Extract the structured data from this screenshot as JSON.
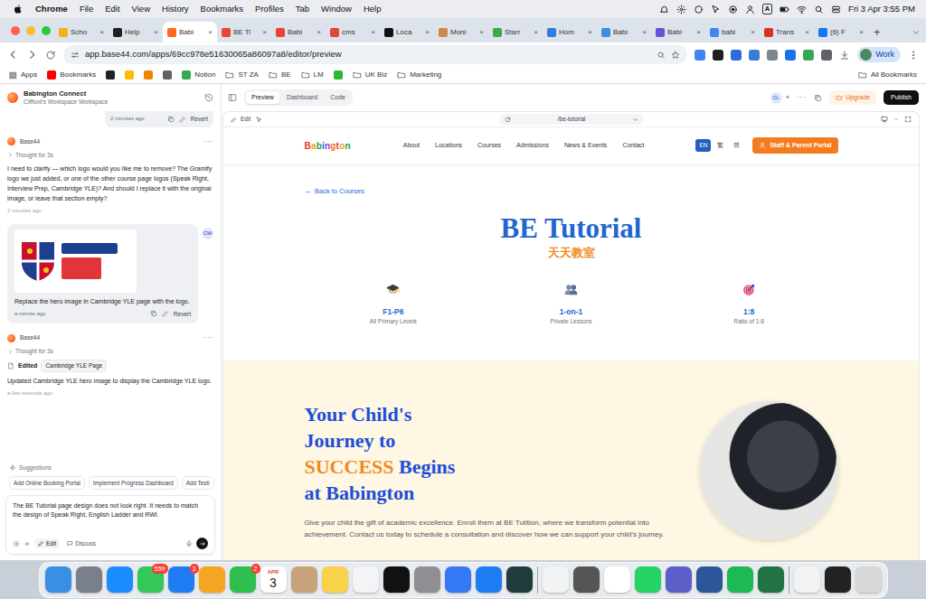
{
  "menubar": {
    "app": "Chrome",
    "menus": [
      "File",
      "Edit",
      "View",
      "History",
      "Bookmarks",
      "Profiles",
      "Tab",
      "Window",
      "Help"
    ],
    "input_source": "A",
    "clock": "Fri 3 Apr 3:55 PM"
  },
  "browser": {
    "tabs": [
      {
        "label": "Scho",
        "selected": false,
        "color": "#f2b01e"
      },
      {
        "label": "Help",
        "selected": false,
        "color": "#202124"
      },
      {
        "label": "Babi",
        "selected": true,
        "color": "#ff6a1f"
      },
      {
        "label": "BE Ti",
        "selected": false,
        "color": "#e8453c"
      },
      {
        "label": "Babi",
        "selected": false,
        "color": "#ea4335"
      },
      {
        "label": "cms",
        "selected": false,
        "color": "#e0463a"
      },
      {
        "label": "Loca",
        "selected": false,
        "color": "#111111"
      },
      {
        "label": "Moni",
        "selected": false,
        "color": "#c98b4b"
      },
      {
        "label": "Starr",
        "selected": false,
        "color": "#3ea84a"
      },
      {
        "label": "Hom",
        "selected": false,
        "color": "#2f7de1"
      },
      {
        "label": "Babi",
        "selected": false,
        "color": "#3b8fe0"
      },
      {
        "label": "Babi",
        "selected": false,
        "color": "#6b4fd8"
      },
      {
        "label": "babi",
        "selected": false,
        "color": "#4285f4"
      },
      {
        "label": "Trans",
        "selected": false,
        "color": "#d93025"
      },
      {
        "label": "(6) F",
        "selected": false,
        "color": "#1877f2"
      }
    ],
    "tab_close": "×",
    "new_tab": "+",
    "url": "app.base44.com/apps/69cc978e51630065a86097a8/editor/preview",
    "extensions": [
      {
        "color": "#4285f4"
      },
      {
        "color": "#1f1f1f"
      },
      {
        "color": "#2c6bd8"
      },
      {
        "color": "#3a7bd5"
      },
      {
        "color": "#7d8590"
      },
      {
        "color": "#1a73e8"
      },
      {
        "color": "#34a853"
      },
      {
        "color": "#5f6368"
      }
    ],
    "profile": "Work",
    "bookmarks": [
      {
        "kind": "apps",
        "label": "Apps"
      },
      {
        "kind": "link",
        "label": "Bookmarks",
        "color": "#ff0000"
      },
      {
        "kind": "icon",
        "color": "#202124"
      },
      {
        "kind": "icon",
        "color": "#fbbc04"
      },
      {
        "kind": "icon",
        "color": "#ea8600"
      },
      {
        "kind": "icon",
        "color": "#5f6368"
      },
      {
        "kind": "link",
        "label": "Notion",
        "color": "#34a853"
      },
      {
        "kind": "folder",
        "label": "ST ZA"
      },
      {
        "kind": "folder",
        "label": "BE"
      },
      {
        "kind": "folder",
        "label": "LM"
      },
      {
        "kind": "icon",
        "color": "#2eb82e"
      },
      {
        "kind": "folder",
        "label": "UK Biz"
      },
      {
        "kind": "folder",
        "label": "Marketing"
      }
    ],
    "all_bookmarks": "All Bookmarks"
  },
  "app": {
    "project": {
      "name": "Babington Connect",
      "workspace": "Clifford's Workspace Workspace"
    },
    "chat": {
      "messages": [
        {
          "kind": "user-tail",
          "time": "2 minutes ago",
          "action": "Revert"
        },
        {
          "kind": "assistant",
          "author": "Base44",
          "menu": "···",
          "thought": "Thought for 3s",
          "text": "I need to clarify — which logo would you like me to remove? The Gramify logo we just added, or one of the other course page logos (Speak Right, Interview Prep, Cambridge YLE)? And should I replace it with the original image, or leave that section empty?",
          "time": "2 minutes ago"
        },
        {
          "kind": "user",
          "avatar": "CW",
          "text": "Replace the hero image in Cambridge YLE page with the logo.",
          "time": "a minute ago",
          "action": "Revert"
        },
        {
          "kind": "assistant-edit",
          "author": "Base44",
          "menu": "···",
          "thought": "Thought for 3s",
          "edited": "Edited",
          "file": "Cambridge YLE Page",
          "text": "Updated Cambridge YLE hero image to display the Cambridge YLE logo.",
          "time": "a few seconds ago"
        }
      ],
      "suggestions_label": "Suggestions",
      "suggestions": [
        "Add Online Booking Portal",
        "Implement Progress Dashboard",
        "Add Testi"
      ],
      "input": "The BE Tutorial page design does not look right. It needs to match the design of Speak Right, English Ladder and RWI.",
      "modes": [
        {
          "label": "Edit",
          "selected": true
        },
        {
          "label": "Discuss",
          "selected": false
        }
      ]
    },
    "views": [
      {
        "label": "Preview",
        "selected": true
      },
      {
        "label": "Dashboard",
        "selected": false
      },
      {
        "label": "Code",
        "selected": false
      }
    ],
    "collaborator": "CL",
    "invite": "+",
    "more": "···",
    "upgrade": "Upgrade",
    "publish": "Publish",
    "preview_edit": "Edit",
    "route": "/be-tutorial"
  },
  "site": {
    "logo": "Babington",
    "nav": [
      "About",
      "Locations",
      "Courses",
      "Admissions",
      "News & Events",
      "Contact"
    ],
    "languages": [
      {
        "label": "EN",
        "selected": true
      },
      {
        "label": "繁",
        "selected": false
      },
      {
        "label": "简",
        "selected": false
      }
    ],
    "portal": "Staff & Parent Portal",
    "back_arrow": "←",
    "back": "Back to Courses",
    "title": "BE Tutorial",
    "subtitle": "天天教室",
    "stats": [
      {
        "kind": "cap",
        "value": "F1-P6",
        "label": "All Primary Levels"
      },
      {
        "kind": "people",
        "value": "1-on-1",
        "label": "Private Lessons"
      },
      {
        "kind": "target",
        "value": "1:8",
        "label": "Ratio of 1:8"
      }
    ],
    "hero": {
      "heading_before": "Your Child's Journey to",
      "highlight": "SUCCESS",
      "heading_after": "Begins at Babington",
      "text": "Give your child the gift of academic excellence. Enroll them at BE Tutition, where we transform potential into achievement. Contact us today to schedule a consultation and discover how we can support your child's journey."
    }
  },
  "dock": {
    "items": [
      {
        "kind": "app",
        "color": "#3a8ee6"
      },
      {
        "kind": "app",
        "color": "#7a7f8c"
      },
      {
        "kind": "app",
        "color": "#1a8cff"
      },
      {
        "kind": "app",
        "color": "#34c759",
        "badge": "559"
      },
      {
        "kind": "app",
        "color": "#1f7cf2",
        "badge": "3"
      },
      {
        "kind": "app",
        "color": "#f5a623"
      },
      {
        "kind": "app",
        "color": "#2fbf4f",
        "badge": "2"
      },
      {
        "kind": "calendar",
        "month": "APR",
        "day": "3"
      },
      {
        "kind": "app",
        "color": "#c8a27a"
      },
      {
        "kind": "app",
        "color": "#f7d24a"
      },
      {
        "kind": "app",
        "color": "#f4f4f6"
      },
      {
        "kind": "app",
        "color": "#111111"
      },
      {
        "kind": "app",
        "color": "#8e8e93"
      },
      {
        "kind": "app",
        "color": "#3478f6"
      },
      {
        "kind": "app",
        "color": "#1d7cf2"
      },
      {
        "kind": "app",
        "color": "#1f3b3c"
      },
      {
        "kind": "separator"
      },
      {
        "kind": "app",
        "color": "#f1f3f4"
      },
      {
        "kind": "app",
        "color": "#555555"
      },
      {
        "kind": "app",
        "color": "#ffffff"
      },
      {
        "kind": "app",
        "color": "#25d366"
      },
      {
        "kind": "app",
        "color": "#5b5fc7"
      },
      {
        "kind": "app",
        "color": "#2b579a"
      },
      {
        "kind": "app",
        "color": "#1db954"
      },
      {
        "kind": "app",
        "color": "#217346"
      },
      {
        "kind": "separator"
      },
      {
        "kind": "app",
        "color": "#f2f2f2"
      },
      {
        "kind": "app",
        "color": "#222222"
      },
      {
        "kind": "app",
        "color": "#d8d8d8"
      }
    ]
  }
}
